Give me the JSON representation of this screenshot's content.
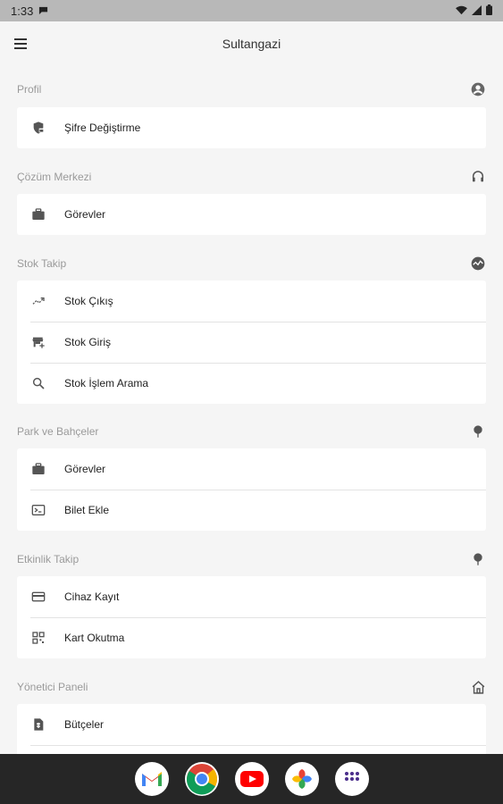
{
  "status_bar": {
    "time": "1:33",
    "icons": [
      "notification-icon",
      "wifi-icon",
      "signal-icon",
      "battery-icon"
    ]
  },
  "app_bar": {
    "title": "Sultangazi",
    "menu_icon": "hamburger-menu-icon"
  },
  "sections": [
    {
      "title": "Profil",
      "icon": "account-circle-icon",
      "items": [
        {
          "label": "Şifre Değiştirme",
          "icon": "shield-lock-icon"
        }
      ]
    },
    {
      "title": "Çözüm Merkezi",
      "icon": "headset-icon",
      "items": [
        {
          "label": "Görevler",
          "icon": "briefcase-icon"
        }
      ]
    },
    {
      "title": "Stok Takip",
      "icon": "chart-circle-icon",
      "items": [
        {
          "label": "Stok Çıkış",
          "icon": "trending-icon"
        },
        {
          "label": "Stok Giriş",
          "icon": "store-add-icon"
        },
        {
          "label": "Stok İşlem Arama",
          "icon": "search-icon"
        }
      ]
    },
    {
      "title": "Park ve Bahçeler",
      "icon": "tree-icon",
      "items": [
        {
          "label": "Görevler",
          "icon": "briefcase-icon"
        },
        {
          "label": "Bilet Ekle",
          "icon": "terminal-box-icon"
        }
      ]
    },
    {
      "title": "Etkinlik Takip",
      "icon": "tree-icon",
      "items": [
        {
          "label": "Cihaz Kayıt",
          "icon": "credit-card-icon"
        },
        {
          "label": "Kart Okutma",
          "icon": "qr-code-icon"
        }
      ]
    },
    {
      "title": "Yönetici Paneli",
      "icon": "home-icon",
      "items": [
        {
          "label": "Bütçeler",
          "icon": "document-icon"
        },
        {
          "label": "",
          "icon": ""
        }
      ]
    }
  ],
  "dock": [
    "gmail-icon",
    "chrome-icon",
    "youtube-icon",
    "photos-icon",
    "app-drawer-icon"
  ],
  "colors": {
    "accent_icon": "#555555",
    "header_text": "#9a9a9a",
    "nav_bg": "#262626"
  }
}
